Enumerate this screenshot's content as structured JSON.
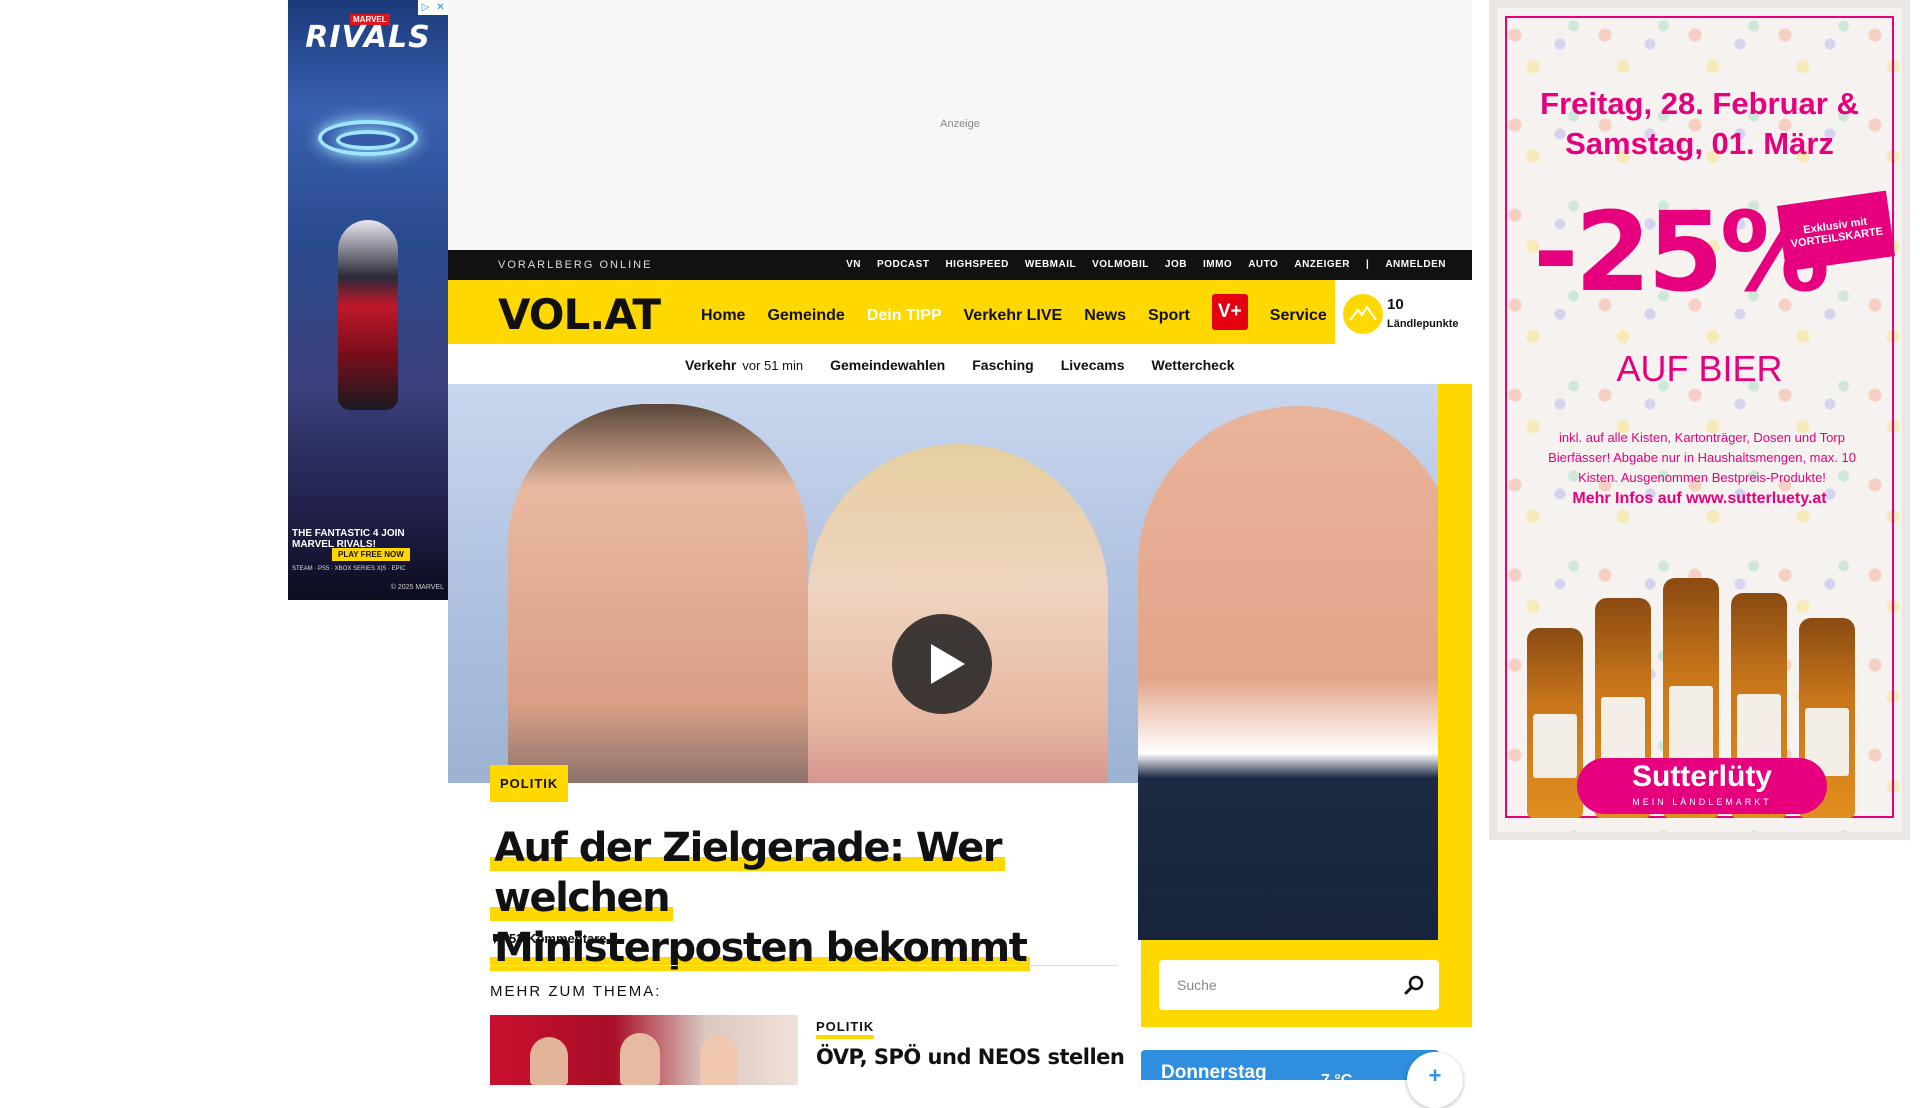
{
  "ad_left": {
    "marvel": "MARVEL",
    "brand": "RIVALS",
    "tagline": "THE FANTASTIC 4 JOIN MARVEL RIVALS!",
    "cta": "PLAY FREE NOW",
    "platforms": "STEAM · PS5 · XBOX SERIES X|S · EPIC",
    "copyright": "© 2025 MARVEL",
    "adchoice_info": "▷",
    "adchoice_close": "✕"
  },
  "ad_top": {
    "label": "Anzeige"
  },
  "topbar": {
    "site": "VORARLBERG ONLINE",
    "links": [
      "VN",
      "PODCAST",
      "HIGHSPEED",
      "WEBMAIL",
      "VOLMOBIL",
      "JOB",
      "IMMO",
      "AUTO",
      "ANZEIGER",
      "|",
      "ANMELDEN"
    ]
  },
  "nav": {
    "logo": "VOL.AT",
    "items": [
      "Home",
      "Gemeinde",
      "Dein TIPP",
      "Verkehr LIVE",
      "News",
      "Sport"
    ],
    "vplus": "V+",
    "service": "Service",
    "points_value": "10",
    "points_label": "Ländlepunkte"
  },
  "subnav": {
    "verkehr": "Verkehr",
    "verkehr_time": "vor 51 min",
    "items": [
      "Gemeindewahlen",
      "Fasching",
      "Livecams",
      "Wettercheck"
    ]
  },
  "article": {
    "category": "POLITIK",
    "headline_line1": "Auf der Zielgerade: Wer welchen",
    "headline_line2": "Ministerposten bekommt",
    "comments": "53 Kommentare",
    "more_label": "MEHR ZUM THEMA:",
    "related_category": "POLITIK",
    "related_title": "ÖVP, SPÖ und NEOS stellen"
  },
  "sidebar": {
    "search_placeholder": "Suche",
    "weather_day": "Donnerstag",
    "weather_temp": "7 °C",
    "weather_more": "+"
  },
  "ad_right": {
    "date_line1": "Freitag, 28. Februar &",
    "date_line2": "Samstag, 01. März",
    "discount": "-25%",
    "badge": "Exklusiv mit VORTEILSKARTE",
    "sub": "AUF BIER",
    "small": "inkl. auf alle Kisten, Kartonträger, Dosen und Torp Bierfässer! Abgabe nur in Haushaltsmengen, max. 10 Kisten. Ausgenommen Bestpreis-Produkte!",
    "more": "Mehr Infos auf www.sutterluety.at",
    "brand": "Sutterlüty",
    "brand_sub": "MEIN LÄNDLEMARKT"
  },
  "colors": {
    "brand_yellow": "#ffd800",
    "vplus_red": "#e3000f",
    "ad_pink": "#e6007e",
    "weather_blue": "#2f8fde"
  }
}
